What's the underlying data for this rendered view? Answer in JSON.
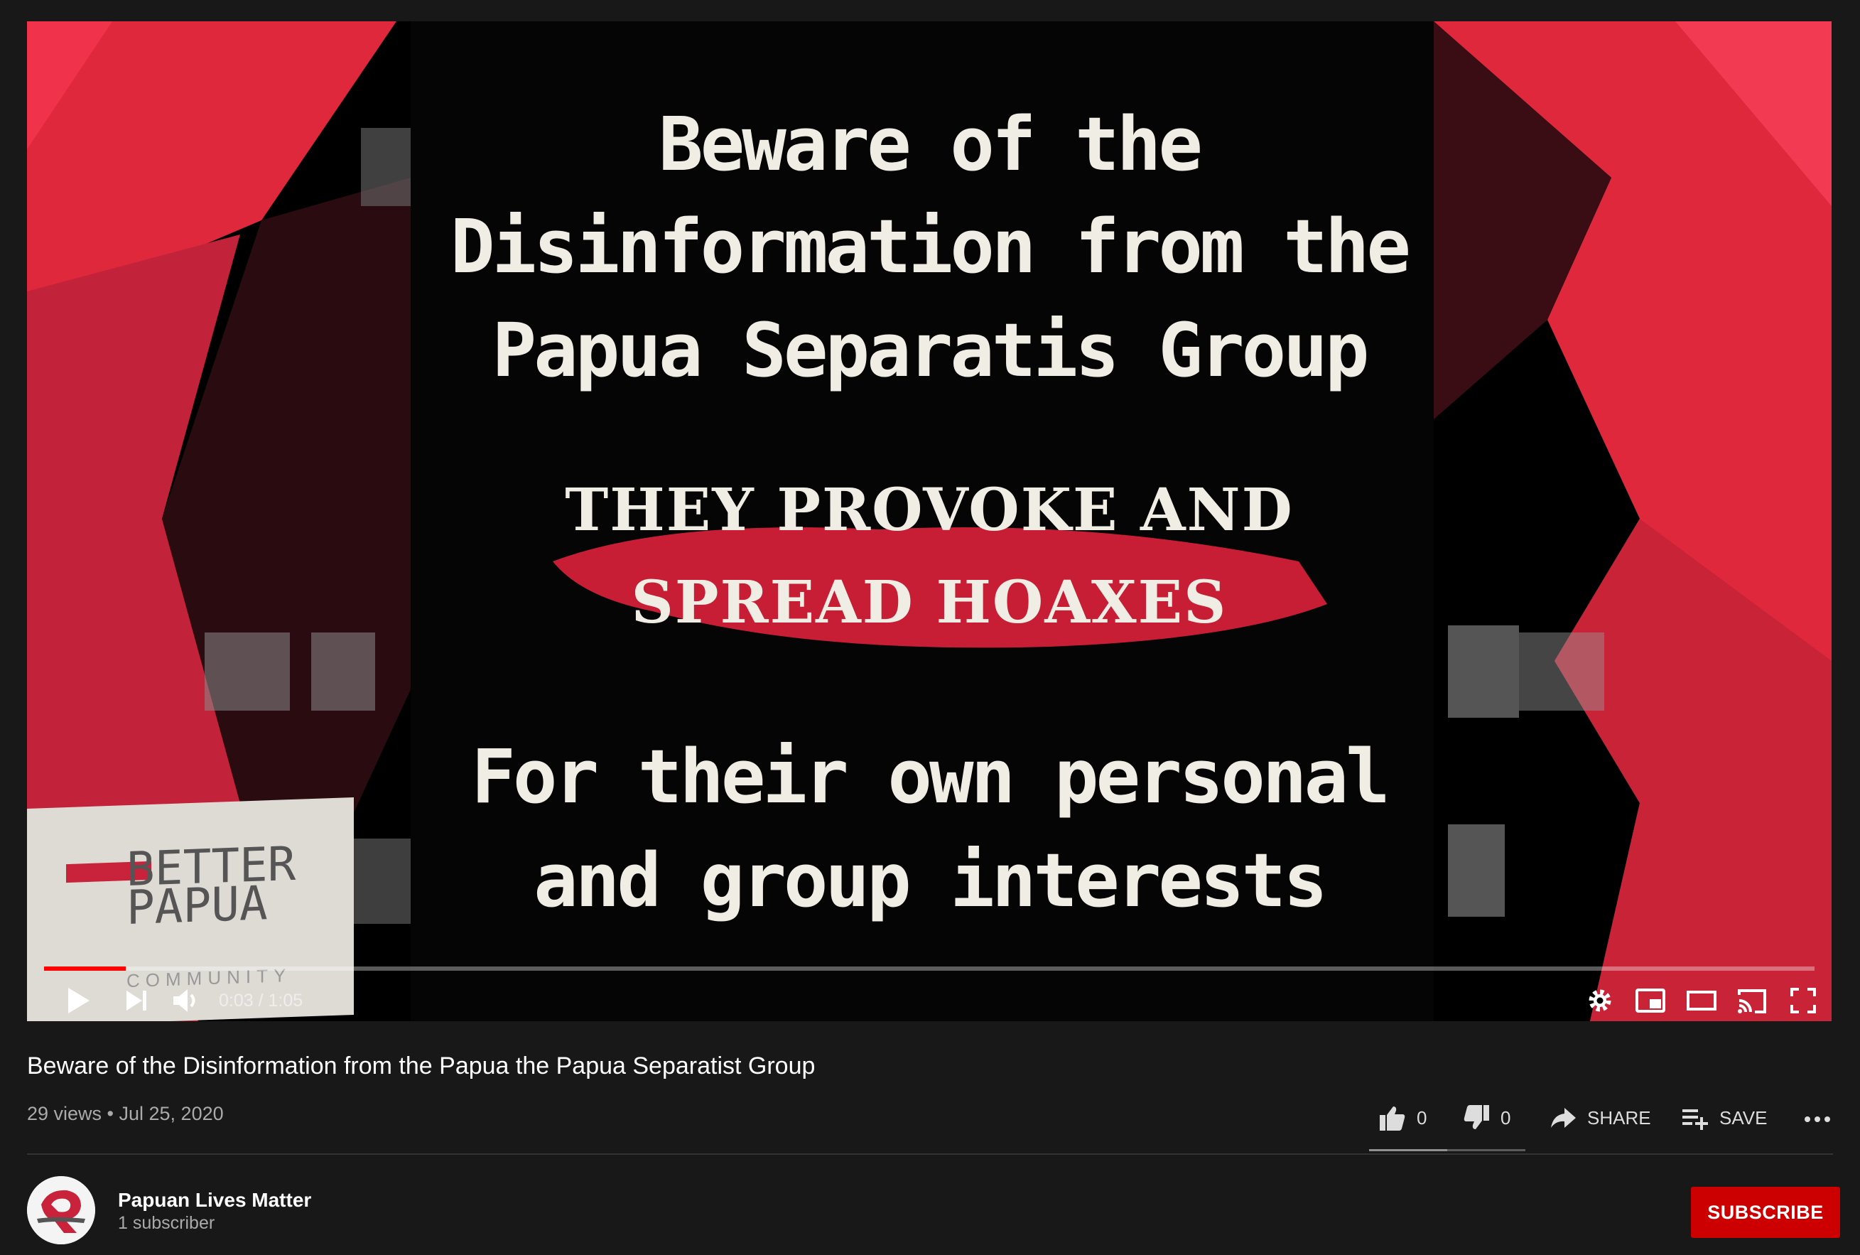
{
  "player": {
    "frame_text": {
      "line1": "Beware of the",
      "line2": "Disinformation from the",
      "line3": "Papua Separatis Group",
      "line4": "THEY PROVOKE AND",
      "line5": "SPREAD HOAXES",
      "line6": "For their own personal",
      "line7": "and group interests"
    },
    "watermark": {
      "line1": "BETTER",
      "line2": "PAPUA",
      "line3": "COMMUNITY"
    },
    "time_display": "0:03 / 1:05",
    "progress_fraction": 0.046,
    "colors": {
      "progress": "#ff0000",
      "frame_red": "#e0283c"
    },
    "icons": [
      "play-icon",
      "next-icon",
      "volume-icon",
      "settings-icon",
      "miniplayer-icon",
      "theater-icon",
      "cast-icon",
      "fullscreen-icon"
    ]
  },
  "video": {
    "title": "Beware of the Disinformation from the Papua the Papua Separatist Group",
    "meta": "29 views • Jul 25, 2020"
  },
  "actions": {
    "like_count": "0",
    "dislike_count": "0",
    "share_label": "SHARE",
    "save_label": "SAVE",
    "like_ratio": 0.5
  },
  "channel": {
    "name": "Papuan Lives Matter",
    "subscribers": "1 subscriber",
    "subscribe_label": "SUBSCRIBE",
    "subscribe_color": "#cc0000"
  }
}
